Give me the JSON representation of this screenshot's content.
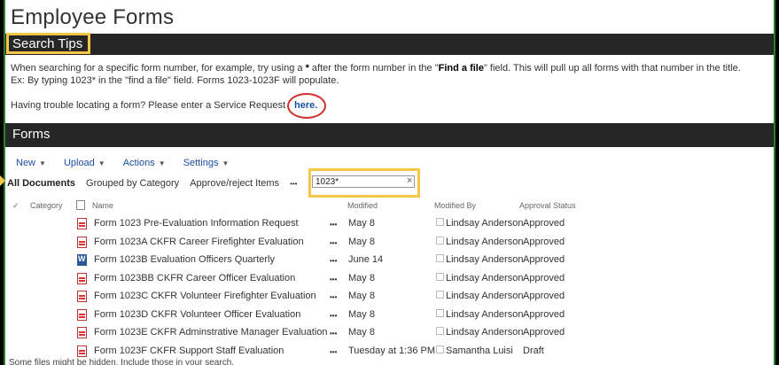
{
  "page": {
    "title": "Employee Forms"
  },
  "search_tips": {
    "heading": "Search Tips",
    "line1_pre": "When searching for a specific form number, for example, try using a ",
    "line1_star": "*",
    "line1_mid": " after the form number in the \"",
    "line1_bold": "Find a file",
    "line1_post": "\" field.   This will pull up all forms with that number in the title.",
    "line2": "Ex: By typing 1023* in the \"find a file\" field.  Forms 1023-1023F will populate.",
    "trouble_text": "Having trouble locating a form?  Please enter a Service Request",
    "here_link": "here."
  },
  "forms": {
    "heading": "Forms",
    "toolbar": {
      "new": "New",
      "upload": "Upload",
      "actions": "Actions",
      "settings": "Settings"
    },
    "views": {
      "all": "All Documents",
      "grouped": "Grouped by Category",
      "approve": "Approve/reject Items",
      "more": "•••"
    },
    "search": {
      "value": "1023*",
      "clear": "×"
    },
    "columns": {
      "category": "Category",
      "name": "Name",
      "modified": "Modified",
      "modified_by": "Modified By",
      "approval": "Approval Status"
    },
    "rows": [
      {
        "name": "Form 1023 Pre-Evaluation Information Request",
        "modified": "May 8",
        "by": "Lindsay Anderson",
        "status": "Approved",
        "icon": "pdf-icon"
      },
      {
        "name": "Form 1023A CKFR Career Firefighter Evaluation",
        "modified": "May 8",
        "by": "Lindsay Anderson",
        "status": "Approved",
        "icon": "pdf-icon"
      },
      {
        "name": "Form 1023B Evaluation Officers Quarterly",
        "modified": "June 14",
        "by": "Lindsay Anderson",
        "status": "Approved",
        "icon": "word-icon"
      },
      {
        "name": "Form 1023BB CKFR Career Officer Evaluation",
        "modified": "May 8",
        "by": "Lindsay Anderson",
        "status": "Approved",
        "icon": "pdf-icon"
      },
      {
        "name": "Form 1023C CKFR Volunteer Firefighter Evaluation",
        "modified": "May 8",
        "by": "Lindsay Anderson",
        "status": "Approved",
        "icon": "pdf-icon"
      },
      {
        "name": "Form 1023D CKFR Volunteer Officer Evaluation",
        "modified": "May 8",
        "by": "Lindsay Anderson",
        "status": "Approved",
        "icon": "pdf-icon"
      },
      {
        "name": "Form 1023E CKFR Adminstrative Manager Evaluation",
        "modified": "May 8",
        "by": "Lindsay Anderson",
        "status": "Approved",
        "icon": "pdf-icon"
      },
      {
        "name": "Form 1023F CKFR Support Staff Evaluation",
        "modified": "Tuesday at 1:36 PM",
        "by": "Samantha Luisi",
        "status": "Draft",
        "icon": "pdf-icon"
      }
    ],
    "footer_note": "Some files might be hidden. Include those in your search."
  }
}
